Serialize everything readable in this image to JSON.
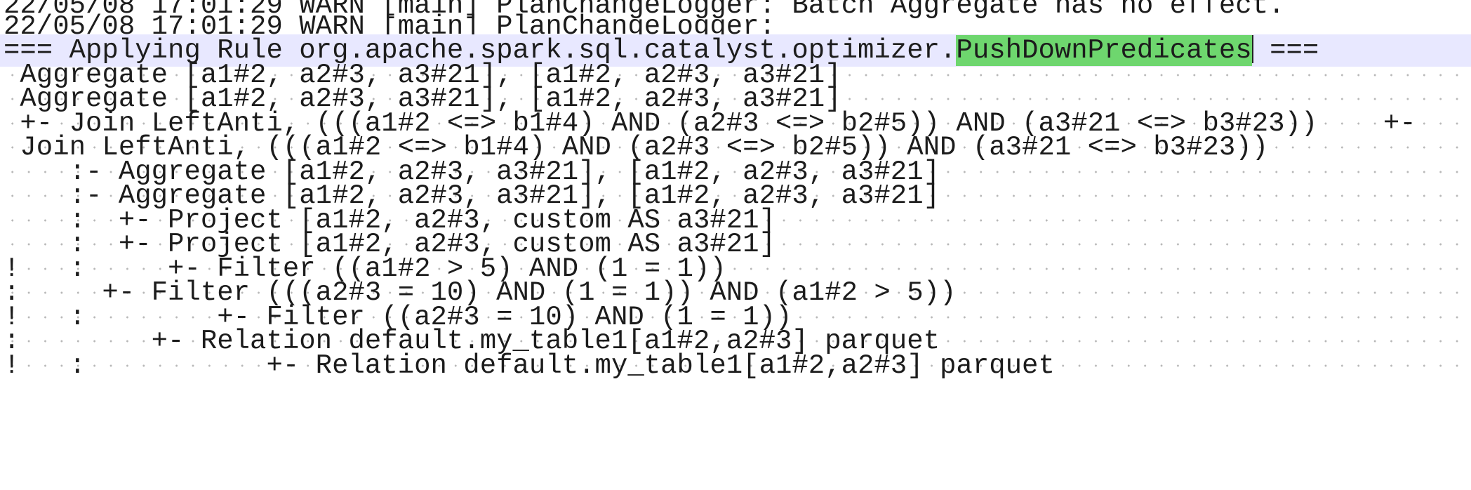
{
  "editor": {
    "lines": [
      "22/05/08 17:01:29 WARN [main] PlanChangeLogger: Batch Aggregate has no effect.",
      "22/05/08 17:01:29 WARN [main] PlanChangeLogger: ",
      "",
      " Aggregate [a1#2, a2#3, a3#21], [a1#2, a2#3, a3#21]",
      " Aggregate [a1#2, a2#3, a3#21], [a1#2, a2#3, a3#21]",
      " +- Join LeftAnti, (((a1#2 <=> b1#4) AND (a2#3 <=> b2#5)) AND (a3#21 <=> b3#23))    +-",
      " Join LeftAnti, (((a1#2 <=> b1#4) AND (a2#3 <=> b2#5)) AND (a3#21 <=> b3#23))",
      "    :- Aggregate [a1#2, a2#3, a3#21], [a1#2, a2#3, a3#21]",
      "    :- Aggregate [a1#2, a2#3, a3#21], [a1#2, a2#3, a3#21]",
      "    :  +- Project [a1#2, a2#3, custom AS a3#21]",
      "    :  +- Project [a1#2, a2#3, custom AS a3#21]",
      "!   :     +- Filter ((a1#2 > 5) AND (1 = 1))",
      ":     +- Filter (((a2#3 = 10) AND (1 = 1)) AND (a1#2 > 5))",
      "!   :        +- Filter ((a2#3 = 10) AND (1 = 1))",
      ":        +- Relation default.my_table1[a1#2,a2#3] parquet",
      "!   :           +- Relation default.my_table1[a1#2,a2#3] parquet"
    ],
    "current_line": {
      "prefix": "=== Applying Rule org.apache.spark.sql.catalyst.optimizer.",
      "selected": "PushDownPredicates",
      "suffix": " ==="
    }
  }
}
